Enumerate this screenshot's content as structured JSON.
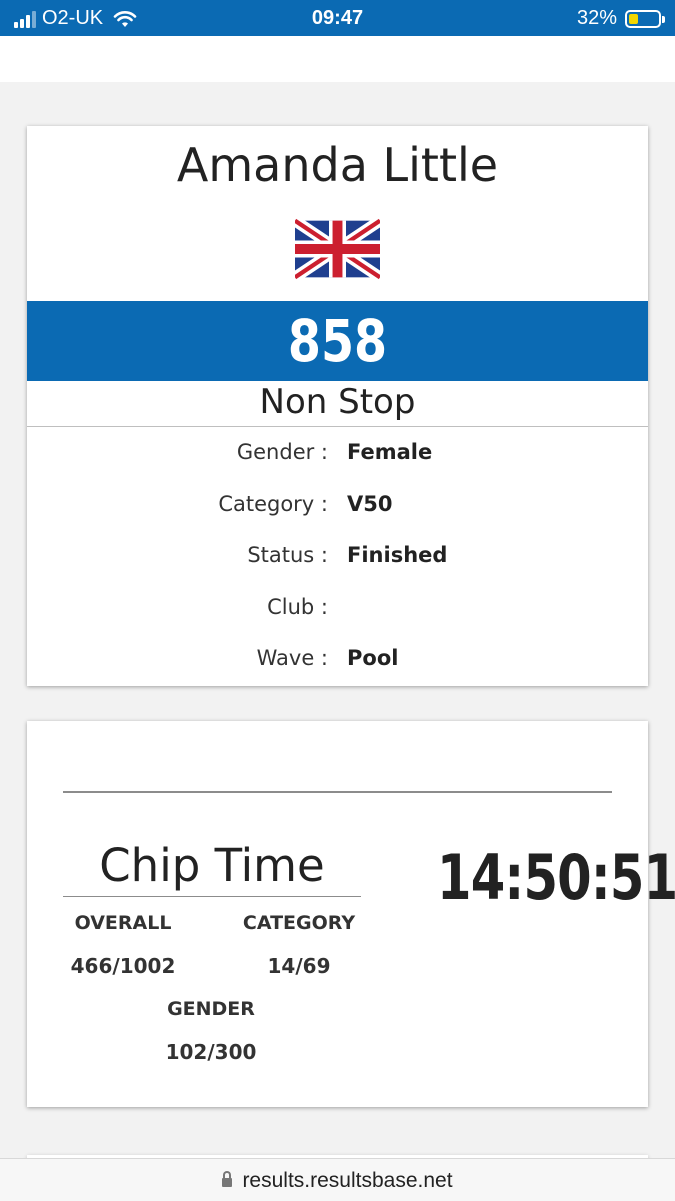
{
  "status_bar": {
    "carrier": "O2-UK",
    "time": "09:47",
    "battery": "32%",
    "battery_level": 0.32
  },
  "athlete": {
    "name": "Amanda Little",
    "flag": "uk-flag-icon",
    "bib": "858",
    "race": "Non Stop"
  },
  "details": [
    {
      "label": "Gender :",
      "value": "Female"
    },
    {
      "label": "Category :",
      "value": "V50"
    },
    {
      "label": "Status :",
      "value": "Finished"
    },
    {
      "label": "Club :",
      "value": ""
    },
    {
      "label": "Wave :",
      "value": "Pool"
    }
  ],
  "result": {
    "chip_label": "Chip Time",
    "chip_time": "14:50:51",
    "overall_label": "OVERALL",
    "overall_value": "466/1002",
    "category_label": "CATEGORY",
    "category_value": "14/69",
    "gender_label": "GENDER",
    "gender_value": "102/300"
  },
  "browser": {
    "url": "results.resultsbase.net"
  },
  "colors": {
    "brand_blue": "#0b6ab3",
    "battery_yellow": "#f2d600"
  }
}
